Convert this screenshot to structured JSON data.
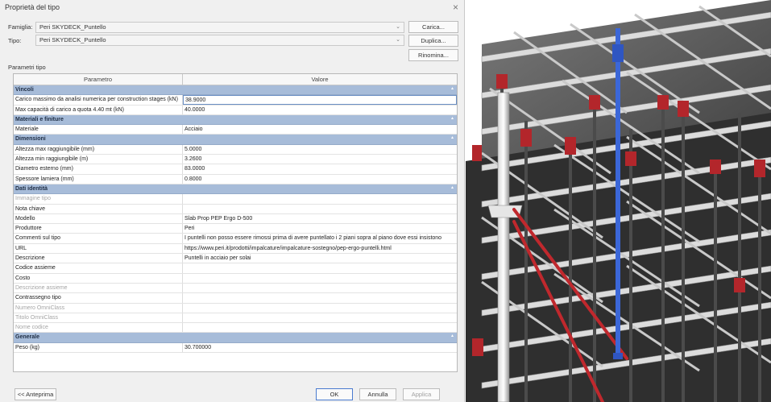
{
  "dialog": {
    "title": "Proprietà del tipo",
    "close_glyph": "×",
    "family_label": "Famiglia:",
    "family_value": "Peri SKYDECK_Puntello",
    "type_label": "Tipo:",
    "type_value": "Peri SKYDECK_Puntello",
    "load_button": "Carica...",
    "duplicate_button": "Duplica...",
    "rename_button": "Rinomina...",
    "params_caption": "Parametri tipo",
    "columns": {
      "param": "Parametro",
      "value": "Valore"
    },
    "groups": {
      "vincoli": "Vincoli",
      "materiali": "Materiali e finiture",
      "dimensioni": "Dimensioni",
      "identita": "Dati identità",
      "generale": "Generale"
    },
    "rows": {
      "carico_massimo": {
        "label": "Carico massimo da analisi numerica per construction stages (kN)",
        "value": "38.9000"
      },
      "max_capacita": {
        "label": "Max capacità di carico a quota 4.40 mt (kN)",
        "value": "40.0000"
      },
      "materiale": {
        "label": "Materiale",
        "value": "Acciaio"
      },
      "altezza_max": {
        "label": "Altezza max raggiungibile (mm)",
        "value": "5.0000"
      },
      "altezza_min": {
        "label": "Altezza min raggiungibile (m)",
        "value": "3.2600"
      },
      "diametro": {
        "label": "Diametro esterno (mm)",
        "value": "83.0000"
      },
      "spessore": {
        "label": "Spessore lamiera (mm)",
        "value": "0.8000"
      },
      "immagine_tipo": {
        "label": "Immagine tipo",
        "value": ""
      },
      "nota_chiave": {
        "label": "Nota chiave",
        "value": ""
      },
      "modello": {
        "label": "Modello",
        "value": "Slab Prop PEP Ergo D-500"
      },
      "produttore": {
        "label": "Produttore",
        "value": "Peri"
      },
      "commenti": {
        "label": "Commenti sul tipo",
        "value": "I puntelli non posso essere rimossi prima di avere puntellato i 2 piani sopra al piano dove essi insistono"
      },
      "url": {
        "label": "URL",
        "value": "https://www.peri.it/prodotti/impalcature/impalcature-sostegno/pep-ergo-puntelli.html"
      },
      "descrizione": {
        "label": "Descrizione",
        "value": "Puntelli in acciaio per solai"
      },
      "codice_assieme": {
        "label": "Codice assieme",
        "value": ""
      },
      "costo": {
        "label": "Costo",
        "value": ""
      },
      "descrizione_assieme": {
        "label": "Descrizione assieme",
        "value": ""
      },
      "contrassegno": {
        "label": "Contrassegno tipo",
        "value": ""
      },
      "numero_omniclass": {
        "label": "Numero OmniClass",
        "value": ""
      },
      "titolo_omniclass": {
        "label": "Titolo OmniClass",
        "value": ""
      },
      "nome_codice": {
        "label": "Nome codice",
        "value": ""
      },
      "peso": {
        "label": "Peso (kg)",
        "value": "30.700000"
      }
    },
    "preview_button": "<< Anteprima",
    "ok_button": "OK",
    "cancel_button": "Annulla",
    "apply_button": "Applica"
  },
  "colors": {
    "group_header": "#a7bcd9",
    "prop_red": "#b3262b",
    "brace_red": "#c0282d",
    "selected_blue": "#3b67d8",
    "beam_gray": "#5a5a5a"
  }
}
